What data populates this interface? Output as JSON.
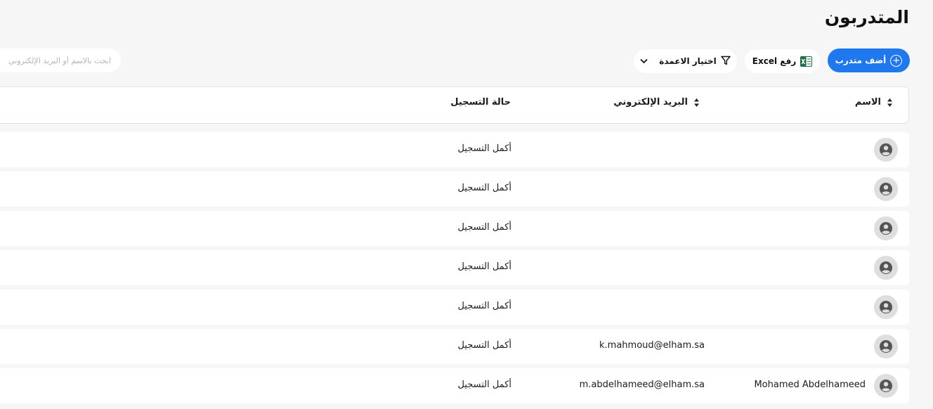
{
  "page": {
    "title": "المتدربون"
  },
  "toolbar": {
    "add_label": "أضف متدرب",
    "excel_label": "رفع Excel",
    "columns_label": "اختيار الاعمدة",
    "search_placeholder": "ابحث بالاسم أو البريد الإلكتروني"
  },
  "table": {
    "headers": {
      "name": "الاسم",
      "email": "البريد الإلكتروني",
      "status": "حالة التسجيل"
    },
    "rows": [
      {
        "name": "",
        "email": "",
        "status": "أكمل التسجيل"
      },
      {
        "name": "",
        "email": "",
        "status": "أكمل التسجيل"
      },
      {
        "name": "",
        "email": "",
        "status": "أكمل التسجيل"
      },
      {
        "name": "",
        "email": "",
        "status": "أكمل التسجيل"
      },
      {
        "name": "",
        "email": "",
        "status": "أكمل التسجيل"
      },
      {
        "name": "",
        "email": "k.mahmoud@elham.sa",
        "status": "أكمل التسجيل"
      },
      {
        "name": "Mohamed Abdelhameed",
        "email": "m.abdelhameed@elham.sa",
        "status": "أكمل التسجيل"
      }
    ]
  },
  "icons": {
    "add": "plus-circle-icon",
    "excel": "excel-file-icon",
    "filter": "filter-icon",
    "chevron": "chevron-down-icon",
    "sort": "sort-icon",
    "avatar": "user-circle-icon"
  },
  "colors": {
    "primary": "#1f78ee",
    "excel_green": "#1d6f42",
    "background": "#f6f6f6",
    "avatar_bg": "#dedede",
    "avatar_fg": "#555555"
  }
}
